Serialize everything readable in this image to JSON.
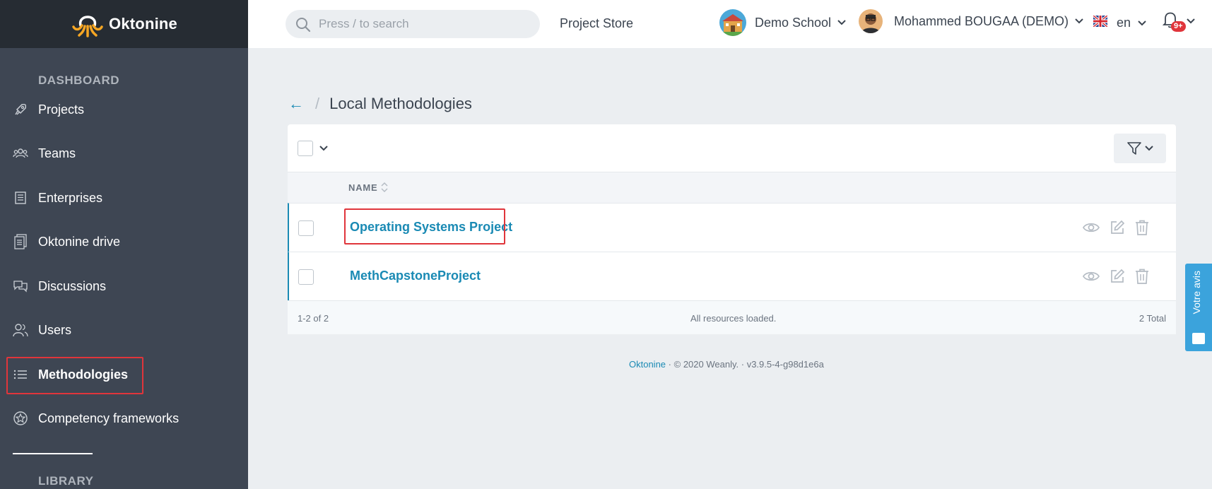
{
  "app": {
    "name": "Oktonine"
  },
  "search": {
    "placeholder": "Press / to search"
  },
  "topbar": {
    "project_store": "Project Store",
    "school": "Demo School",
    "user": "Mohammed BOUGAA (DEMO)",
    "language": "en",
    "notifications_badge": "9+"
  },
  "sidebar": {
    "section_dashboard": "DASHBOARD",
    "section_library": "LIBRARY",
    "items": [
      {
        "label": "Projects",
        "icon": "rocket-icon"
      },
      {
        "label": "Teams",
        "icon": "teams-icon"
      },
      {
        "label": "Enterprises",
        "icon": "building-icon"
      },
      {
        "label": "Oktonine drive",
        "icon": "drive-icon"
      },
      {
        "label": "Discussions",
        "icon": "chat-icon"
      },
      {
        "label": "Users",
        "icon": "users-icon"
      },
      {
        "label": "Methodologies",
        "icon": "list-icon",
        "active": true
      },
      {
        "label": "Competency frameworks",
        "icon": "badge-icon"
      }
    ]
  },
  "page": {
    "title": "Local Methodologies",
    "back_label": "←"
  },
  "table": {
    "column_name": "NAME",
    "rows": [
      {
        "name": "Operating Systems Project"
      },
      {
        "name": "MethCapstoneProject"
      }
    ],
    "footer_range": "1-2 of 2",
    "footer_status": "All resources loaded.",
    "footer_total": "2 Total"
  },
  "footer": {
    "brand": "Oktonine",
    "copyright": "© 2020 Weanly.",
    "version": "v3.9.5-4-g98d1e6a"
  },
  "feedback": {
    "label": "Votre avis"
  },
  "colors": {
    "accent": "#1a8ab4",
    "sidebar": "#3e4653",
    "highlight": "#e0353b",
    "feedback": "#3ba3dc"
  }
}
